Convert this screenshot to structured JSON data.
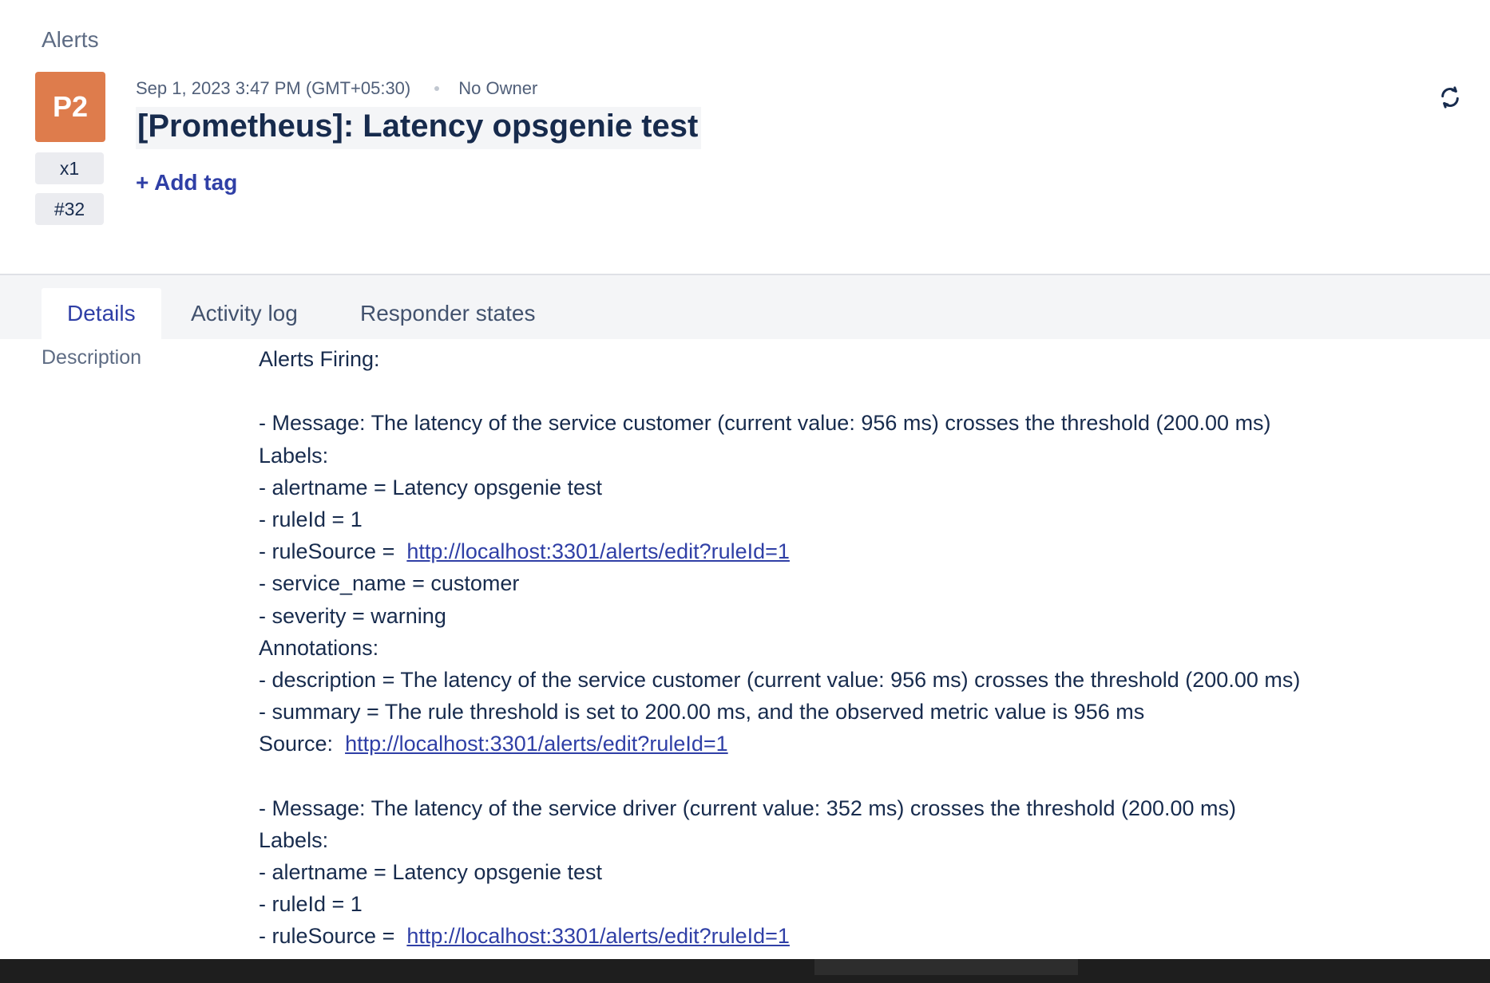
{
  "breadcrumb": "Alerts",
  "alert": {
    "priority": "P2",
    "count": "x1",
    "tiny_id": "#32",
    "created_at": "Sep 1, 2023 3:47 PM (GMT+05:30)",
    "owner": "No Owner",
    "title": "[Prometheus]: Latency opsgenie test",
    "add_tag_label": "+ Add tag",
    "priority_color": "#de7c4c"
  },
  "icons": {
    "refresh": "refresh-icon"
  },
  "tabs": [
    {
      "label": "Details",
      "active": true
    },
    {
      "label": "Activity log",
      "active": false
    },
    {
      "label": "Responder states",
      "active": false
    }
  ],
  "details": {
    "description_label": "Description",
    "lines": [
      {
        "text": "Alerts Firing:"
      },
      {
        "text": ""
      },
      {
        "text": "- Message: The latency of the service customer (current value: 956 ms) crosses the threshold (200.00 ms)"
      },
      {
        "text": "Labels:"
      },
      {
        "text": "- alertname = Latency opsgenie test"
      },
      {
        "text": "- ruleId = 1"
      },
      {
        "text": "- ruleSource = ",
        "link": "http://localhost:3301/alerts/edit?ruleId=1"
      },
      {
        "text": "- service_name = customer"
      },
      {
        "text": "- severity = warning"
      },
      {
        "text": "Annotations:"
      },
      {
        "text": "- description = The latency of the service customer (current value: 956 ms) crosses the threshold (200.00 ms)"
      },
      {
        "text": "- summary = The rule threshold is set to 200.00 ms, and the observed metric value is 956 ms"
      },
      {
        "text": "Source: ",
        "link": "http://localhost:3301/alerts/edit?ruleId=1"
      },
      {
        "text": ""
      },
      {
        "text": "- Message: The latency of the service driver (current value: 352 ms) crosses the threshold (200.00 ms)"
      },
      {
        "text": "Labels:"
      },
      {
        "text": "- alertname = Latency opsgenie test"
      },
      {
        "text": "- ruleId = 1"
      },
      {
        "text": "- ruleSource = ",
        "link": "http://localhost:3301/alerts/edit?ruleId=1"
      }
    ]
  },
  "colors": {
    "link": "#2f3fa6",
    "text": "#172b4d",
    "muted": "#5e6c84",
    "tab_bar": "#f4f5f7"
  }
}
